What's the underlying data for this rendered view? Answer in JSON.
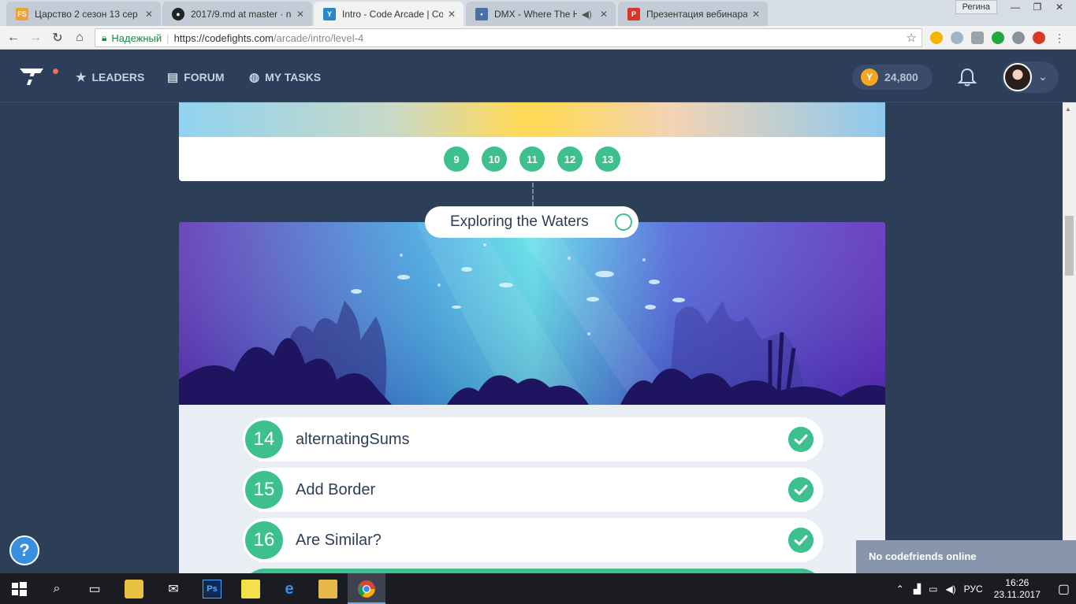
{
  "browser": {
    "tabs": [
      {
        "title": "Царство 2 сезон 13 сер",
        "favicon": "fs-favicon",
        "color": "#f0a030",
        "active": false
      },
      {
        "title": "2017/9.md at master · n",
        "favicon": "github-favicon",
        "color": "#222222",
        "active": false
      },
      {
        "title": "Intro - Code Arcade | Co",
        "favicon": "codefights-favicon",
        "color": "#2a88c9",
        "active": true
      },
      {
        "title": "DMX - Where The Ho",
        "favicon": "vk-favicon",
        "color": "#4a6ea5",
        "active": false
      },
      {
        "title": "Презентация вебинара",
        "favicon": "pdf-favicon",
        "color": "#d9342b",
        "active": false
      }
    ],
    "user_label": "Регина",
    "secure_label": "Надежный",
    "url_host": "https://codefights.com",
    "url_path": "/arcade/intro/level-4"
  },
  "header": {
    "nav": [
      {
        "label": "LEADERS",
        "icon": "star-icon"
      },
      {
        "label": "FORUM",
        "icon": "chat-icon"
      },
      {
        "label": "MY TASKS",
        "icon": "tasks-icon"
      }
    ],
    "coins": "24,800"
  },
  "arcade": {
    "previous_levels": [
      "9",
      "10",
      "11",
      "12",
      "13"
    ],
    "chapter_title": "Exploring the Waters",
    "tasks": [
      {
        "number": "14",
        "name": "alternatingSums",
        "solved": true
      },
      {
        "number": "15",
        "name": "Add Border",
        "solved": true
      },
      {
        "number": "16",
        "name": "Are Similar?",
        "solved": true
      }
    ],
    "help_label": "?",
    "codefriends": "No codefriends online"
  },
  "taskbar": {
    "language": "РУС",
    "time": "16:26",
    "date": "23.11.2017"
  },
  "colors": {
    "accent_green": "#3ebf8e",
    "header_bg": "#2c3e59",
    "page_bg": "#2d3e57"
  }
}
